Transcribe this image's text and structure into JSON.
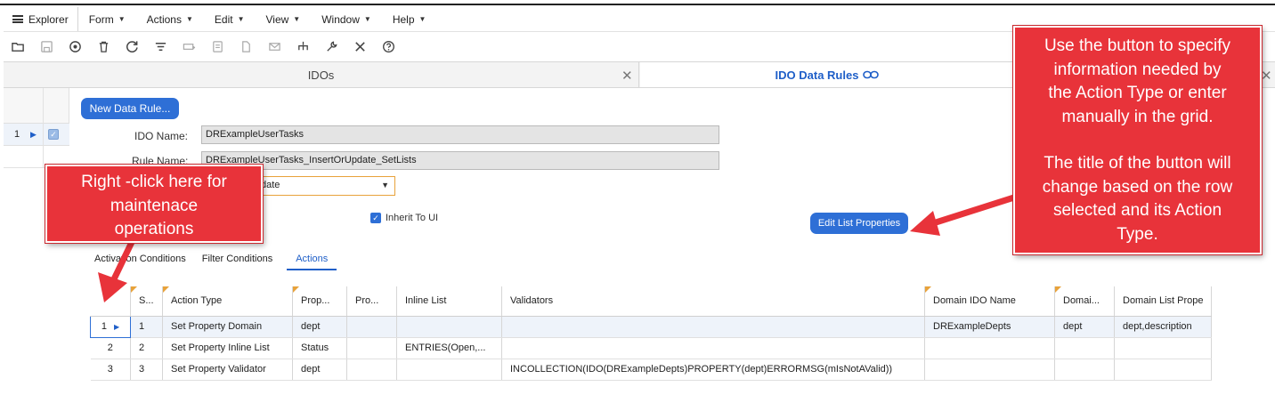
{
  "menubar": {
    "explorer_label": "Explorer",
    "items": [
      "Form",
      "Actions",
      "Edit",
      "View",
      "Window",
      "Help"
    ]
  },
  "toolbar": {
    "icons": [
      "open-folder-icon",
      "save-icon",
      "plus-circle-icon",
      "delete-icon",
      "refresh-icon",
      "filter-icon",
      "filter-place-icon",
      "notes-icon",
      "document-icon",
      "mail-icon",
      "tree-icon",
      "wrench-icon",
      "tools-icon",
      "help-icon"
    ]
  },
  "tabs": {
    "tab1_label": "IDOs",
    "tab2_label": "IDO Data Rules"
  },
  "gutter": {
    "row_number": "1"
  },
  "form": {
    "new_rule_button": "New Data Rule...",
    "ido_name_label": "IDO Name:",
    "ido_name_value": "DRExampleUserTasks",
    "rule_name_label": "Rule Name:",
    "rule_name_value": "DRExampleUserTasks_InsertOrUpdate_SetLists",
    "action_value": "date",
    "inherit_label": "Inherit To UI",
    "edit_list_button": "Edit List Properties"
  },
  "subtabs": {
    "activation": "Activation Conditions",
    "filter": "Filter Conditions",
    "actions": "Actions"
  },
  "grid": {
    "columns": [
      "",
      "S...",
      "Action Type",
      "Prop...",
      "Pro...",
      "Inline List",
      "Validators",
      "Domain IDO Name",
      "Domai...",
      "Domain List Prope"
    ],
    "rows": [
      [
        "1",
        "1",
        "Set Property Domain",
        "dept",
        "",
        "",
        "",
        "DRExampleDepts",
        "dept",
        "dept,description"
      ],
      [
        "2",
        "2",
        "Set Property Inline List",
        "Status",
        "",
        "ENTRIES(Open,...",
        "",
        "",
        "",
        ""
      ],
      [
        "3",
        "3",
        "Set Property Validator",
        "dept",
        "",
        "",
        "INCOLLECTION(IDO(DRExampleDepts)PROPERTY(dept)ERRORMSG(mIsNotAValid))",
        "",
        "",
        ""
      ]
    ]
  },
  "callouts": {
    "left_lines": [
      "Right -click here for",
      "maintenace",
      "operations"
    ],
    "right_lines_a": [
      "Use the button to specify",
      "information needed by",
      "the Action Type or enter",
      "manually in the grid."
    ],
    "right_lines_b": [
      "The title of the button will",
      "change based on the row",
      "selected and its Action",
      "Type."
    ]
  },
  "colors": {
    "accent_blue": "#2e6fd6",
    "callout_red": "#e8333a",
    "required_orange": "#e8a23a"
  }
}
